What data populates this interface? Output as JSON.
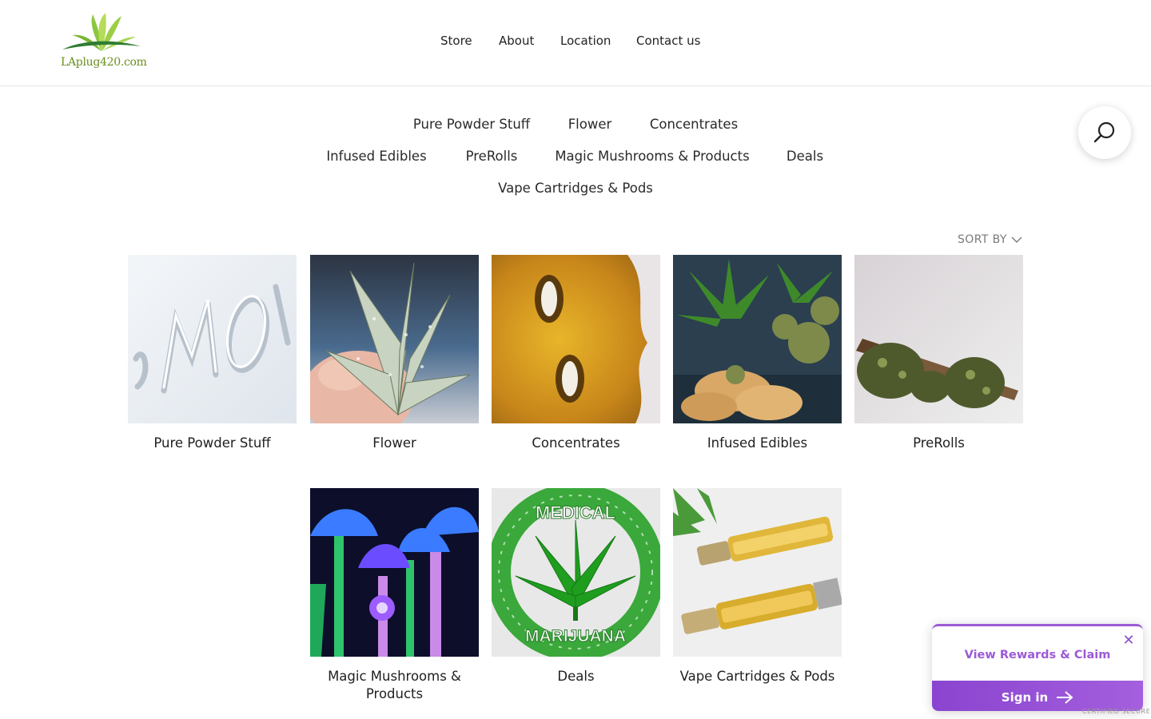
{
  "header": {
    "logo_text": "LAplug420.com",
    "nav": [
      "Store",
      "About",
      "Location",
      "Contact us"
    ]
  },
  "categories_menu": [
    "Pure Powder Stuff",
    "Flower",
    "Concentrates",
    "Infused Edibles",
    "PreRolls",
    "Magic Mushrooms & Products",
    "Deals",
    "Vape Cartridges & Pods"
  ],
  "search": {
    "icon": "search-icon"
  },
  "sort": {
    "label": "SORT BY",
    "icon": "chevron-down-icon"
  },
  "tiles": [
    {
      "name": "Pure Powder Stuff",
      "image": "snow-writing"
    },
    {
      "name": "Flower",
      "image": "frosty-cannabis-leaf"
    },
    {
      "name": "Concentrates",
      "image": "amber-shatter"
    },
    {
      "name": "Infused Edibles",
      "image": "cannabis-cookies"
    },
    {
      "name": "PreRolls",
      "image": "preroll-cone-buds"
    },
    {
      "name": "Magic Mushrooms & Products",
      "image": "neon-mushrooms"
    },
    {
      "name": "Deals",
      "image": "medical-marijuana-badge"
    },
    {
      "name": "Vape Cartridges & Pods",
      "image": "vape-cartridges"
    }
  ],
  "deals_badge": {
    "top": "MEDICAL",
    "bottom": "MARIJUANA"
  },
  "rewards": {
    "link_text": "View Rewards & Claim",
    "signin_text": "Sign in",
    "certified": "CERTIFIED SECURE"
  },
  "colors": {
    "accent": "#9b5ad6",
    "logo_green": "#6b8f1e"
  }
}
